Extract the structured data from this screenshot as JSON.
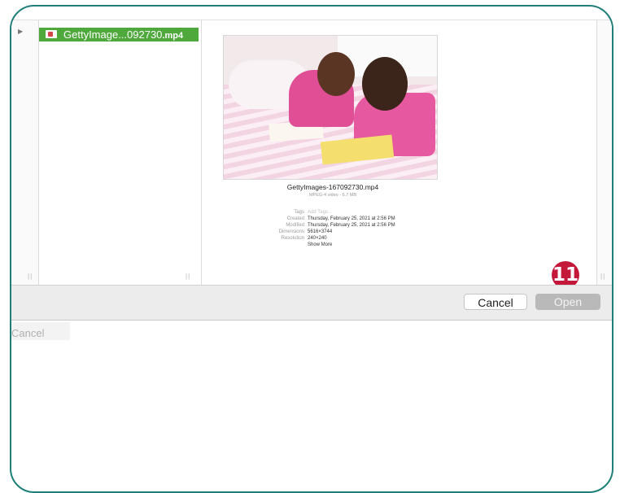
{
  "file_list": {
    "selected_file": "GettyImage...092730",
    "selected_ext": ".mp4"
  },
  "preview": {
    "title": "GettyImages-167092730.mp4",
    "subtitle": "MPEG-4 video - 6.7 MB",
    "info": [
      {
        "key": "Tags",
        "value": "Add Tags..."
      },
      {
        "key": "Created",
        "value": "Thursday, February 25, 2021 at 2:56 PM"
      },
      {
        "key": "Modified",
        "value": "Thursday, February 25, 2021 at 2:56 PM"
      },
      {
        "key": "Dimensions",
        "value": "5616×3744"
      },
      {
        "key": "Resolution",
        "value": "240×240"
      }
    ],
    "show_more": "Show More"
  },
  "badge": "11",
  "buttons": {
    "cancel": "Cancel",
    "open": "Open"
  },
  "background": {
    "ghost_cancel": "Cancel"
  },
  "colors": {
    "frame": "#1f7f78",
    "selection": "#4ea83c",
    "badge": "#c4183a",
    "link": "#3477dc"
  }
}
